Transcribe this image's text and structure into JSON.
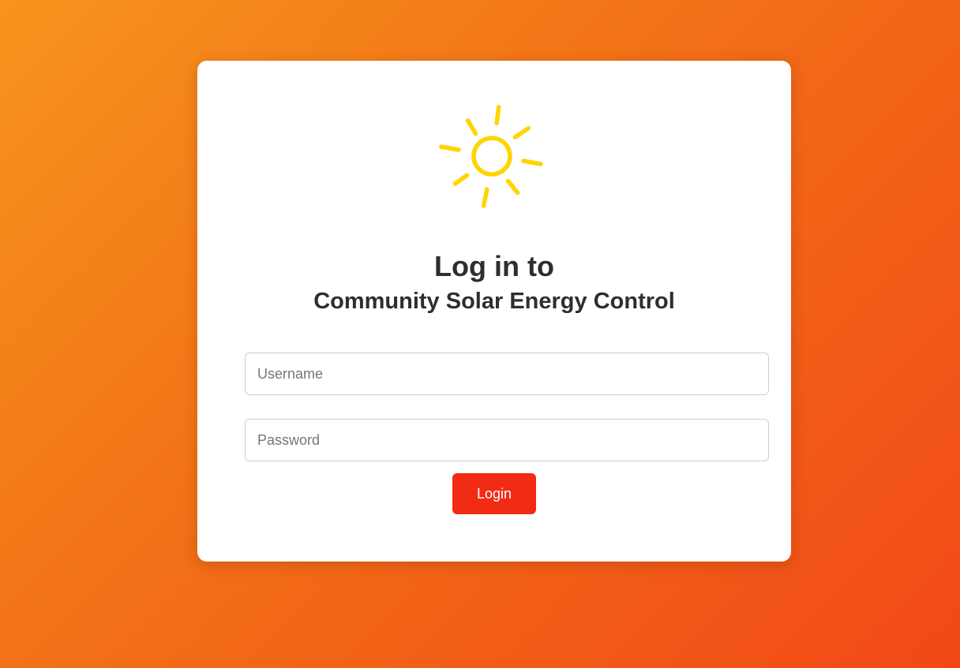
{
  "colors": {
    "background_start": "#f7941d",
    "background_end": "#f24817",
    "card": "#ffffff",
    "sun": "#ffd400",
    "button": "#f22b14",
    "text": "#2e2e2e"
  },
  "logo": {
    "icon": "sun-icon"
  },
  "heading": {
    "title": "Log in to",
    "subtitle": "Community Solar Energy Control"
  },
  "form": {
    "username": {
      "value": "",
      "placeholder": "Username"
    },
    "password": {
      "value": "",
      "placeholder": "Password"
    },
    "login_label": "Login"
  }
}
